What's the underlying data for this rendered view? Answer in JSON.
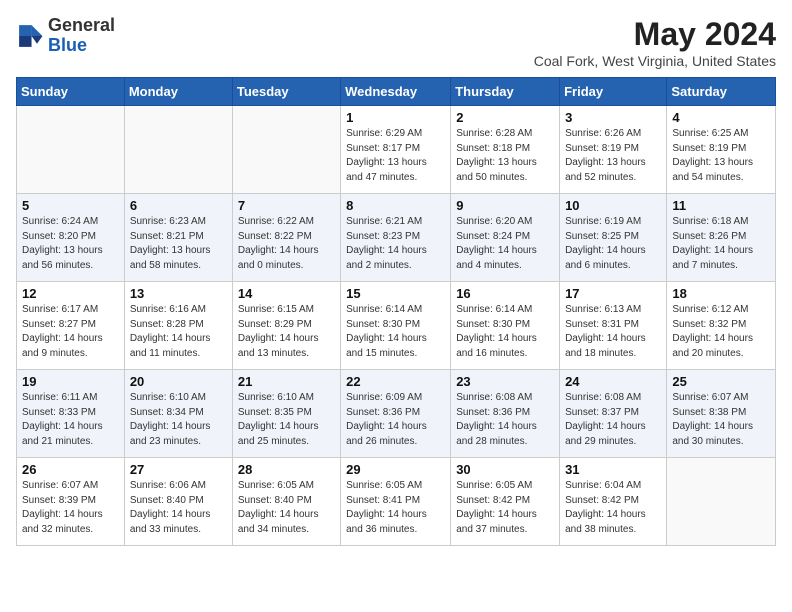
{
  "header": {
    "logo_line1": "General",
    "logo_line2": "Blue",
    "month": "May 2024",
    "location": "Coal Fork, West Virginia, United States"
  },
  "weekdays": [
    "Sunday",
    "Monday",
    "Tuesday",
    "Wednesday",
    "Thursday",
    "Friday",
    "Saturday"
  ],
  "weeks": [
    [
      {
        "day": "",
        "sunrise": "",
        "sunset": "",
        "daylight": ""
      },
      {
        "day": "",
        "sunrise": "",
        "sunset": "",
        "daylight": ""
      },
      {
        "day": "",
        "sunrise": "",
        "sunset": "",
        "daylight": ""
      },
      {
        "day": "1",
        "sunrise": "Sunrise: 6:29 AM",
        "sunset": "Sunset: 8:17 PM",
        "daylight": "Daylight: 13 hours and 47 minutes."
      },
      {
        "day": "2",
        "sunrise": "Sunrise: 6:28 AM",
        "sunset": "Sunset: 8:18 PM",
        "daylight": "Daylight: 13 hours and 50 minutes."
      },
      {
        "day": "3",
        "sunrise": "Sunrise: 6:26 AM",
        "sunset": "Sunset: 8:19 PM",
        "daylight": "Daylight: 13 hours and 52 minutes."
      },
      {
        "day": "4",
        "sunrise": "Sunrise: 6:25 AM",
        "sunset": "Sunset: 8:19 PM",
        "daylight": "Daylight: 13 hours and 54 minutes."
      }
    ],
    [
      {
        "day": "5",
        "sunrise": "Sunrise: 6:24 AM",
        "sunset": "Sunset: 8:20 PM",
        "daylight": "Daylight: 13 hours and 56 minutes."
      },
      {
        "day": "6",
        "sunrise": "Sunrise: 6:23 AM",
        "sunset": "Sunset: 8:21 PM",
        "daylight": "Daylight: 13 hours and 58 minutes."
      },
      {
        "day": "7",
        "sunrise": "Sunrise: 6:22 AM",
        "sunset": "Sunset: 8:22 PM",
        "daylight": "Daylight: 14 hours and 0 minutes."
      },
      {
        "day": "8",
        "sunrise": "Sunrise: 6:21 AM",
        "sunset": "Sunset: 8:23 PM",
        "daylight": "Daylight: 14 hours and 2 minutes."
      },
      {
        "day": "9",
        "sunrise": "Sunrise: 6:20 AM",
        "sunset": "Sunset: 8:24 PM",
        "daylight": "Daylight: 14 hours and 4 minutes."
      },
      {
        "day": "10",
        "sunrise": "Sunrise: 6:19 AM",
        "sunset": "Sunset: 8:25 PM",
        "daylight": "Daylight: 14 hours and 6 minutes."
      },
      {
        "day": "11",
        "sunrise": "Sunrise: 6:18 AM",
        "sunset": "Sunset: 8:26 PM",
        "daylight": "Daylight: 14 hours and 7 minutes."
      }
    ],
    [
      {
        "day": "12",
        "sunrise": "Sunrise: 6:17 AM",
        "sunset": "Sunset: 8:27 PM",
        "daylight": "Daylight: 14 hours and 9 minutes."
      },
      {
        "day": "13",
        "sunrise": "Sunrise: 6:16 AM",
        "sunset": "Sunset: 8:28 PM",
        "daylight": "Daylight: 14 hours and 11 minutes."
      },
      {
        "day": "14",
        "sunrise": "Sunrise: 6:15 AM",
        "sunset": "Sunset: 8:29 PM",
        "daylight": "Daylight: 14 hours and 13 minutes."
      },
      {
        "day": "15",
        "sunrise": "Sunrise: 6:14 AM",
        "sunset": "Sunset: 8:30 PM",
        "daylight": "Daylight: 14 hours and 15 minutes."
      },
      {
        "day": "16",
        "sunrise": "Sunrise: 6:14 AM",
        "sunset": "Sunset: 8:30 PM",
        "daylight": "Daylight: 14 hours and 16 minutes."
      },
      {
        "day": "17",
        "sunrise": "Sunrise: 6:13 AM",
        "sunset": "Sunset: 8:31 PM",
        "daylight": "Daylight: 14 hours and 18 minutes."
      },
      {
        "day": "18",
        "sunrise": "Sunrise: 6:12 AM",
        "sunset": "Sunset: 8:32 PM",
        "daylight": "Daylight: 14 hours and 20 minutes."
      }
    ],
    [
      {
        "day": "19",
        "sunrise": "Sunrise: 6:11 AM",
        "sunset": "Sunset: 8:33 PM",
        "daylight": "Daylight: 14 hours and 21 minutes."
      },
      {
        "day": "20",
        "sunrise": "Sunrise: 6:10 AM",
        "sunset": "Sunset: 8:34 PM",
        "daylight": "Daylight: 14 hours and 23 minutes."
      },
      {
        "day": "21",
        "sunrise": "Sunrise: 6:10 AM",
        "sunset": "Sunset: 8:35 PM",
        "daylight": "Daylight: 14 hours and 25 minutes."
      },
      {
        "day": "22",
        "sunrise": "Sunrise: 6:09 AM",
        "sunset": "Sunset: 8:36 PM",
        "daylight": "Daylight: 14 hours and 26 minutes."
      },
      {
        "day": "23",
        "sunrise": "Sunrise: 6:08 AM",
        "sunset": "Sunset: 8:36 PM",
        "daylight": "Daylight: 14 hours and 28 minutes."
      },
      {
        "day": "24",
        "sunrise": "Sunrise: 6:08 AM",
        "sunset": "Sunset: 8:37 PM",
        "daylight": "Daylight: 14 hours and 29 minutes."
      },
      {
        "day": "25",
        "sunrise": "Sunrise: 6:07 AM",
        "sunset": "Sunset: 8:38 PM",
        "daylight": "Daylight: 14 hours and 30 minutes."
      }
    ],
    [
      {
        "day": "26",
        "sunrise": "Sunrise: 6:07 AM",
        "sunset": "Sunset: 8:39 PM",
        "daylight": "Daylight: 14 hours and 32 minutes."
      },
      {
        "day": "27",
        "sunrise": "Sunrise: 6:06 AM",
        "sunset": "Sunset: 8:40 PM",
        "daylight": "Daylight: 14 hours and 33 minutes."
      },
      {
        "day": "28",
        "sunrise": "Sunrise: 6:05 AM",
        "sunset": "Sunset: 8:40 PM",
        "daylight": "Daylight: 14 hours and 34 minutes."
      },
      {
        "day": "29",
        "sunrise": "Sunrise: 6:05 AM",
        "sunset": "Sunset: 8:41 PM",
        "daylight": "Daylight: 14 hours and 36 minutes."
      },
      {
        "day": "30",
        "sunrise": "Sunrise: 6:05 AM",
        "sunset": "Sunset: 8:42 PM",
        "daylight": "Daylight: 14 hours and 37 minutes."
      },
      {
        "day": "31",
        "sunrise": "Sunrise: 6:04 AM",
        "sunset": "Sunset: 8:42 PM",
        "daylight": "Daylight: 14 hours and 38 minutes."
      },
      {
        "day": "",
        "sunrise": "",
        "sunset": "",
        "daylight": ""
      }
    ]
  ]
}
